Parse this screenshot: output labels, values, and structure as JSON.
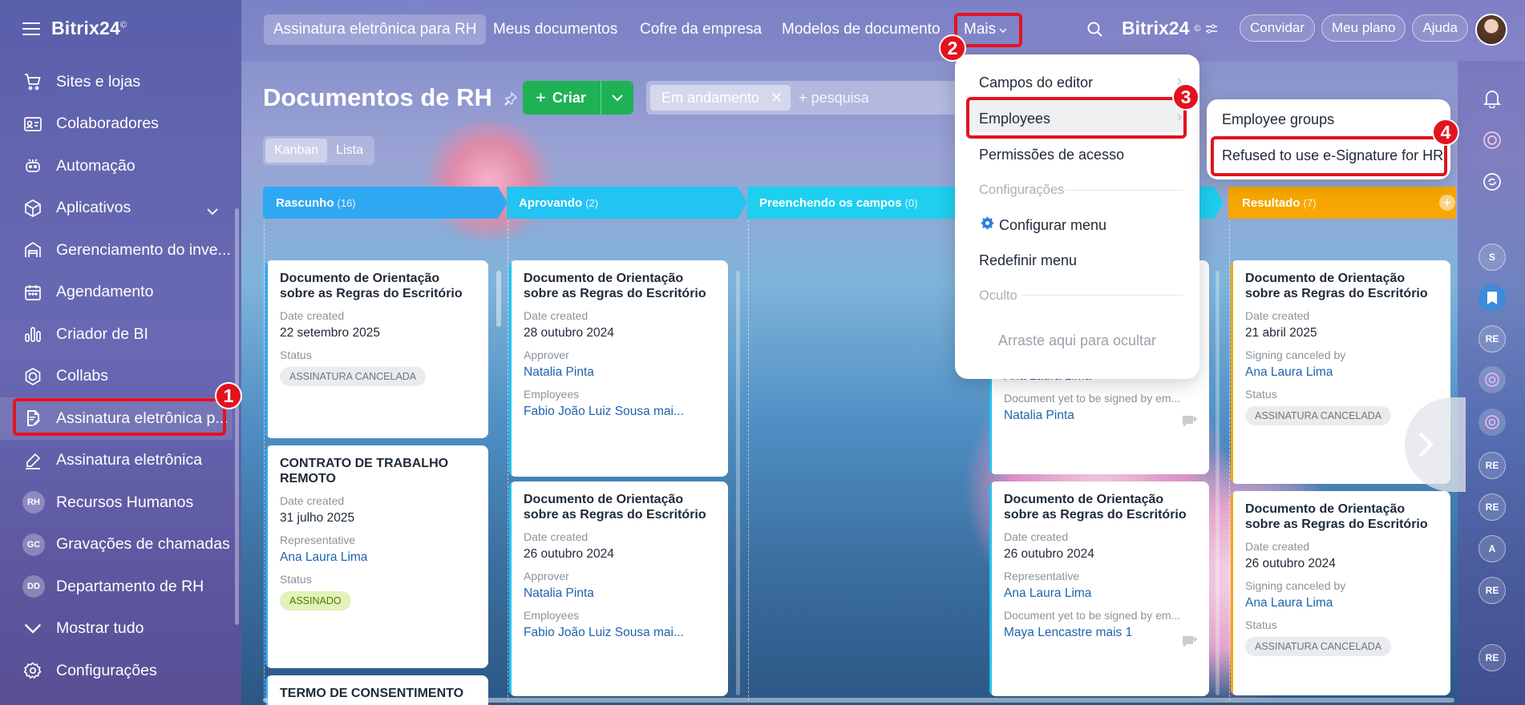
{
  "app": {
    "brand": "Bitrix24",
    "brand_mark": "©"
  },
  "colors": {
    "accent_red": "#e3131e",
    "create_green": "#1eb254",
    "status_ok_bg": "#e3f2b8"
  },
  "sidebar": {
    "items": [
      {
        "label": "Sites e lojas",
        "icon": "cart-icon"
      },
      {
        "label": "Colaboradores",
        "icon": "id-card-icon"
      },
      {
        "label": "Automação",
        "icon": "robot-icon"
      },
      {
        "label": "Aplicativos",
        "icon": "cube-icon"
      },
      {
        "label": "Gerenciamento do inve...",
        "icon": "warehouse-icon"
      },
      {
        "label": "Agendamento",
        "icon": "calendar-icon"
      },
      {
        "label": "Criador de BI",
        "icon": "bar-chart-icon"
      },
      {
        "label": "Collabs",
        "icon": "collabs-icon"
      },
      {
        "label": "Assinatura eletrônica p...",
        "icon": "document-sign-icon"
      },
      {
        "label": "Assinatura eletrônica",
        "icon": "pen-sign-icon"
      },
      {
        "label": "Recursos Humanos",
        "avatar": "RH"
      },
      {
        "label": "Gravações de chamadas",
        "avatar": "GC"
      },
      {
        "label": "Departamento de RH",
        "avatar": "DD"
      },
      {
        "label": "Mostrar tudo",
        "icon": "chevron-down-icon"
      },
      {
        "label": "Configurações",
        "icon": "gear-icon"
      }
    ]
  },
  "topbar": {
    "tabs": [
      "Assinatura eletrônica para RH",
      "Meus documentos",
      "Cofre da empresa",
      "Modelos de documento",
      "Mais"
    ],
    "brand": "Bitrix24",
    "invite": "Convidar",
    "plan": "Meu plano",
    "help": "Ajuda"
  },
  "page": {
    "title": "Documentos de RH",
    "create": "Criar",
    "filter_chip": "Em andamento",
    "search_placeholder": "+ pesquisa",
    "view_kanban": "Kanban",
    "view_list": "Lista"
  },
  "columns": [
    {
      "name": "Rascunho",
      "count": "(16)",
      "color": "#2fa8f2"
    },
    {
      "name": "Aprovando",
      "count": "(2)",
      "color": "#21c4f2"
    },
    {
      "name": "Preenchendo os campos",
      "count": "(0)",
      "color": "#1fcff0"
    },
    {
      "name": "Resultado",
      "count": "(7)",
      "color": "#f7a700"
    }
  ],
  "cards": {
    "c1": {
      "title": "Documento de Orientação sobre as Regras do Escritório",
      "l1": "Date created",
      "v1": "22 setembro 2025",
      "l2": "Status",
      "status": "ASSINATURA CANCELADA"
    },
    "c2": {
      "title": "CONTRATO DE TRABALHO REMOTO",
      "l1": "Date created",
      "v1": "31 julho 2025",
      "l2": "Representative",
      "v2": "Ana Laura Lima",
      "l3": "Status",
      "status": "ASSINADO"
    },
    "c3": {
      "title": "TERMO DE CONSENTIMENTO"
    },
    "c4": {
      "title": "Documento de Orientação sobre as Regras do Escritório",
      "l1": "Date created",
      "v1": "28 outubro 2024",
      "l2": "Approver",
      "v2": "Natalia Pinta",
      "l3": "Employees",
      "v3": "Fabio João Luiz Sousa mai..."
    },
    "c5": {
      "title": "Documento de Orientação sobre as Regras do Escritório",
      "l1": "Date created",
      "v1": "26 outubro 2024",
      "l2": "Approver",
      "v2": "Natalia Pinta",
      "l3": "Employees",
      "v3": "Fabio João Luiz Sousa mai..."
    },
    "c6": {
      "v0": "Ana Laura Lima",
      "l1": "Document yet to be signed by em...",
      "v1": "Natalia Pinta"
    },
    "c7": {
      "title": "Documento de Orientação sobre as Regras do Escritório",
      "l1": "Date created",
      "v1": "26 outubro 2024",
      "l2": "Representative",
      "v2": "Ana Laura Lima",
      "l3": "Document yet to be signed by em...",
      "v3": "Maya Lencastre mais 1"
    },
    "c8": {
      "title": "Documento de Orientação sobre as Regras do Escritório",
      "l1": "Date created",
      "v1": "21 abril 2025",
      "l2": "Signing canceled by",
      "v2": "Ana Laura Lima",
      "l3": "Status",
      "status": "ASSINATURA CANCELADA"
    },
    "c9": {
      "title": "Documento de Orientação sobre as Regras do Escritório",
      "l1": "Date created",
      "v1": "26 outubro 2024",
      "l2": "Signing canceled by",
      "v2": "Ana Laura Lima",
      "l3": "Status",
      "status": "ASSINATURA CANCELADA"
    }
  },
  "menu": {
    "items": [
      "Campos do editor",
      "Employees",
      "Permissões de acesso",
      "Configurações",
      "Configurar menu",
      "Redefinir menu",
      "Oculto",
      "Arraste aqui para ocultar"
    ]
  },
  "submenu": {
    "items": [
      "Employee groups",
      "Refused to use e-Signature for HR"
    ]
  },
  "steps": [
    "1",
    "2",
    "3",
    "4"
  ],
  "rightbar": {
    "avatars": [
      "S",
      "RE",
      "RE",
      "RE",
      "A",
      "RE",
      "RE"
    ]
  }
}
